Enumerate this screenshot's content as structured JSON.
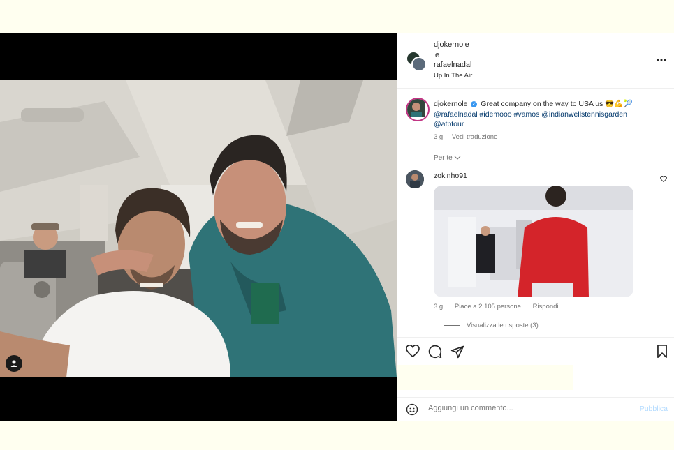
{
  "post": {
    "header": {
      "user1": "djokernole",
      "conjunction": "e",
      "user2": "rafaelnadal",
      "location": "Up In The Air",
      "more_icon": "more-horizontal-icon"
    },
    "caption": {
      "user": "djokernole",
      "text": "Great company on the way to USA us 😎💪🎾",
      "mentions": "@rafaelnadal #idemooo #vamos @indianwellstennisgarden @atptour",
      "time": "3 g",
      "translate": "Vedi traduzione"
    },
    "for_you_label": "Per te",
    "comment": {
      "user": "zokinho91",
      "time": "3 g",
      "likes": "Piace a 2.105 persone",
      "reply": "Rispondi",
      "view_replies": "Visualizza le risposte (3)"
    },
    "add_comment": {
      "placeholder": "Aggiungi un commento...",
      "post_label": "Pubblica"
    }
  }
}
